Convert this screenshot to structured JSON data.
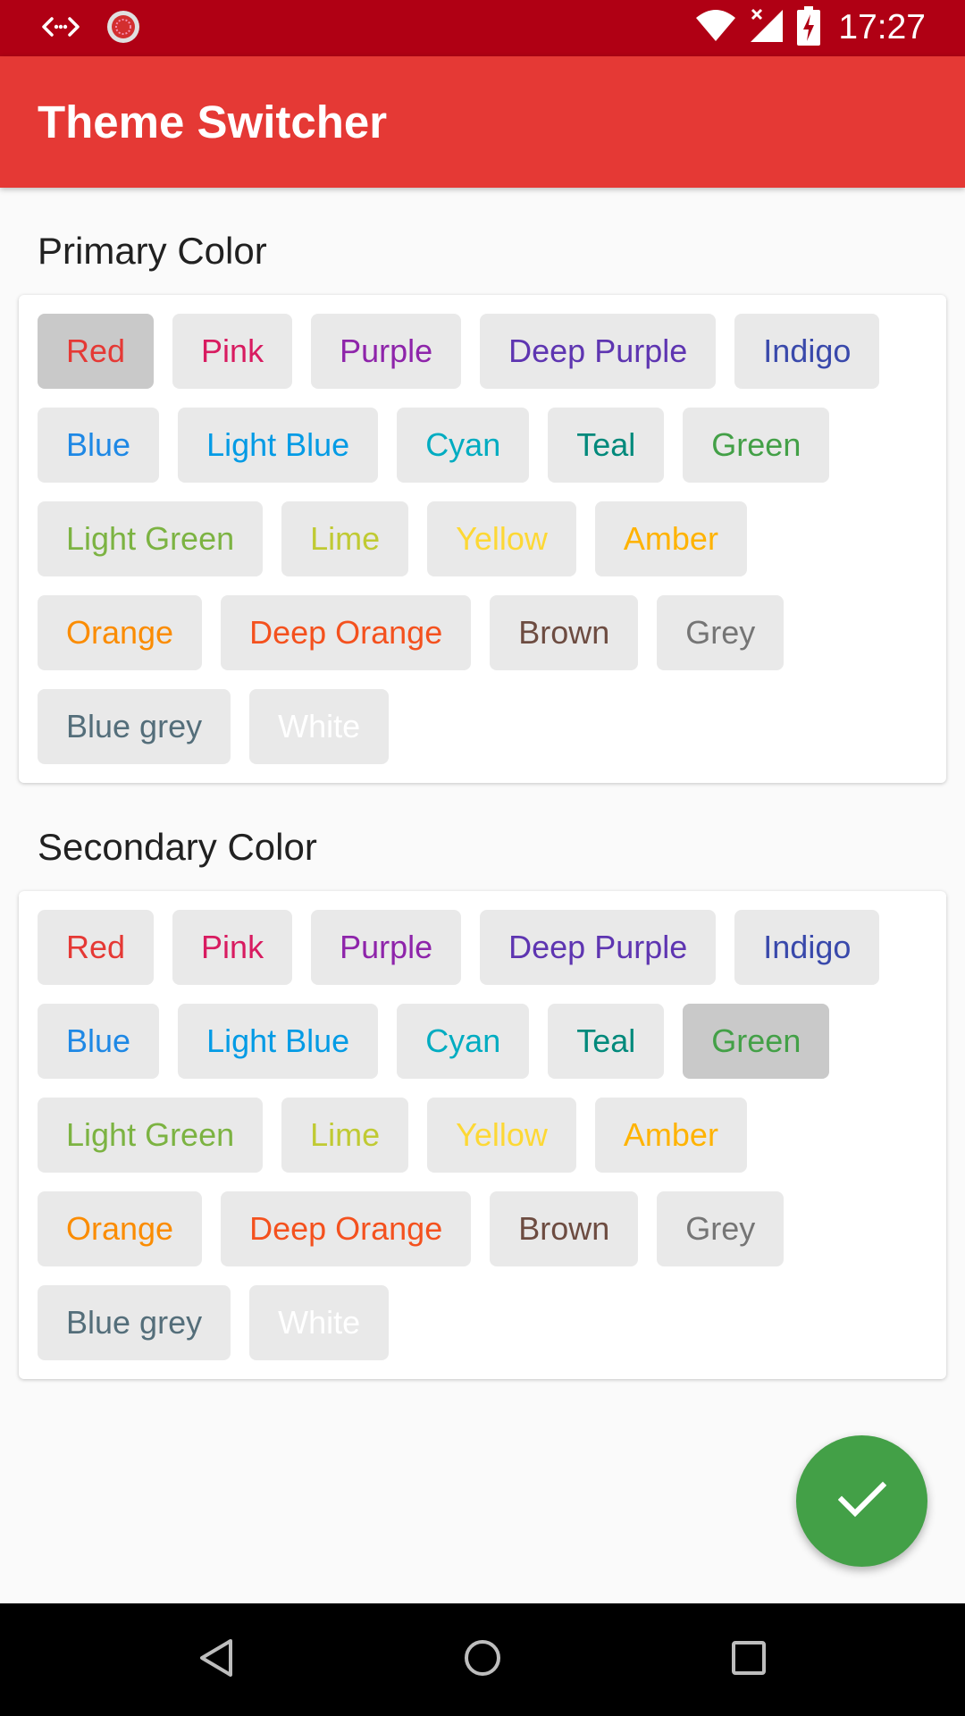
{
  "status_bar": {
    "time": "17:27",
    "icons": [
      "code-arrows-icon",
      "notification-dot-icon",
      "wifi-icon",
      "signal-off-icon",
      "battery-charging-icon"
    ]
  },
  "app_bar": {
    "title": "Theme Switcher"
  },
  "primary": {
    "title": "Primary Color",
    "selected": "Red",
    "chips": [
      {
        "label": "Red",
        "color": "#e53935"
      },
      {
        "label": "Pink",
        "color": "#d81b60"
      },
      {
        "label": "Purple",
        "color": "#8e24aa"
      },
      {
        "label": "Deep Purple",
        "color": "#5e35b1"
      },
      {
        "label": "Indigo",
        "color": "#3949ab"
      },
      {
        "label": "Blue",
        "color": "#1e88e5"
      },
      {
        "label": "Light Blue",
        "color": "#039be5"
      },
      {
        "label": "Cyan",
        "color": "#00acc1"
      },
      {
        "label": "Teal",
        "color": "#00897b"
      },
      {
        "label": "Green",
        "color": "#43a047"
      },
      {
        "label": "Light Green",
        "color": "#7cb342"
      },
      {
        "label": "Lime",
        "color": "#c0ca33"
      },
      {
        "label": "Yellow",
        "color": "#fdd835"
      },
      {
        "label": "Amber",
        "color": "#ffb300"
      },
      {
        "label": "Orange",
        "color": "#fb8c00"
      },
      {
        "label": "Deep Orange",
        "color": "#f4511e"
      },
      {
        "label": "Brown",
        "color": "#6d4c41"
      },
      {
        "label": "Grey",
        "color": "#757575"
      },
      {
        "label": "Blue grey",
        "color": "#546e7a"
      },
      {
        "label": "White",
        "color": "#ffffff"
      }
    ]
  },
  "secondary": {
    "title": "Secondary Color",
    "selected": "Green",
    "chips": [
      {
        "label": "Red",
        "color": "#e53935"
      },
      {
        "label": "Pink",
        "color": "#d81b60"
      },
      {
        "label": "Purple",
        "color": "#8e24aa"
      },
      {
        "label": "Deep Purple",
        "color": "#5e35b1"
      },
      {
        "label": "Indigo",
        "color": "#3949ab"
      },
      {
        "label": "Blue",
        "color": "#1e88e5"
      },
      {
        "label": "Light Blue",
        "color": "#039be5"
      },
      {
        "label": "Cyan",
        "color": "#00acc1"
      },
      {
        "label": "Teal",
        "color": "#00897b"
      },
      {
        "label": "Green",
        "color": "#43a047"
      },
      {
        "label": "Light Green",
        "color": "#7cb342"
      },
      {
        "label": "Lime",
        "color": "#c0ca33"
      },
      {
        "label": "Yellow",
        "color": "#fdd835"
      },
      {
        "label": "Amber",
        "color": "#ffb300"
      },
      {
        "label": "Orange",
        "color": "#fb8c00"
      },
      {
        "label": "Deep Orange",
        "color": "#f4511e"
      },
      {
        "label": "Brown",
        "color": "#6d4c41"
      },
      {
        "label": "Grey",
        "color": "#757575"
      },
      {
        "label": "Blue grey",
        "color": "#546e7a"
      },
      {
        "label": "White",
        "color": "#ffffff"
      }
    ]
  },
  "fab": {
    "icon": "check-icon",
    "color": "#43a047"
  },
  "nav_bar": {
    "buttons": [
      "back-icon",
      "home-icon",
      "recents-icon"
    ]
  }
}
